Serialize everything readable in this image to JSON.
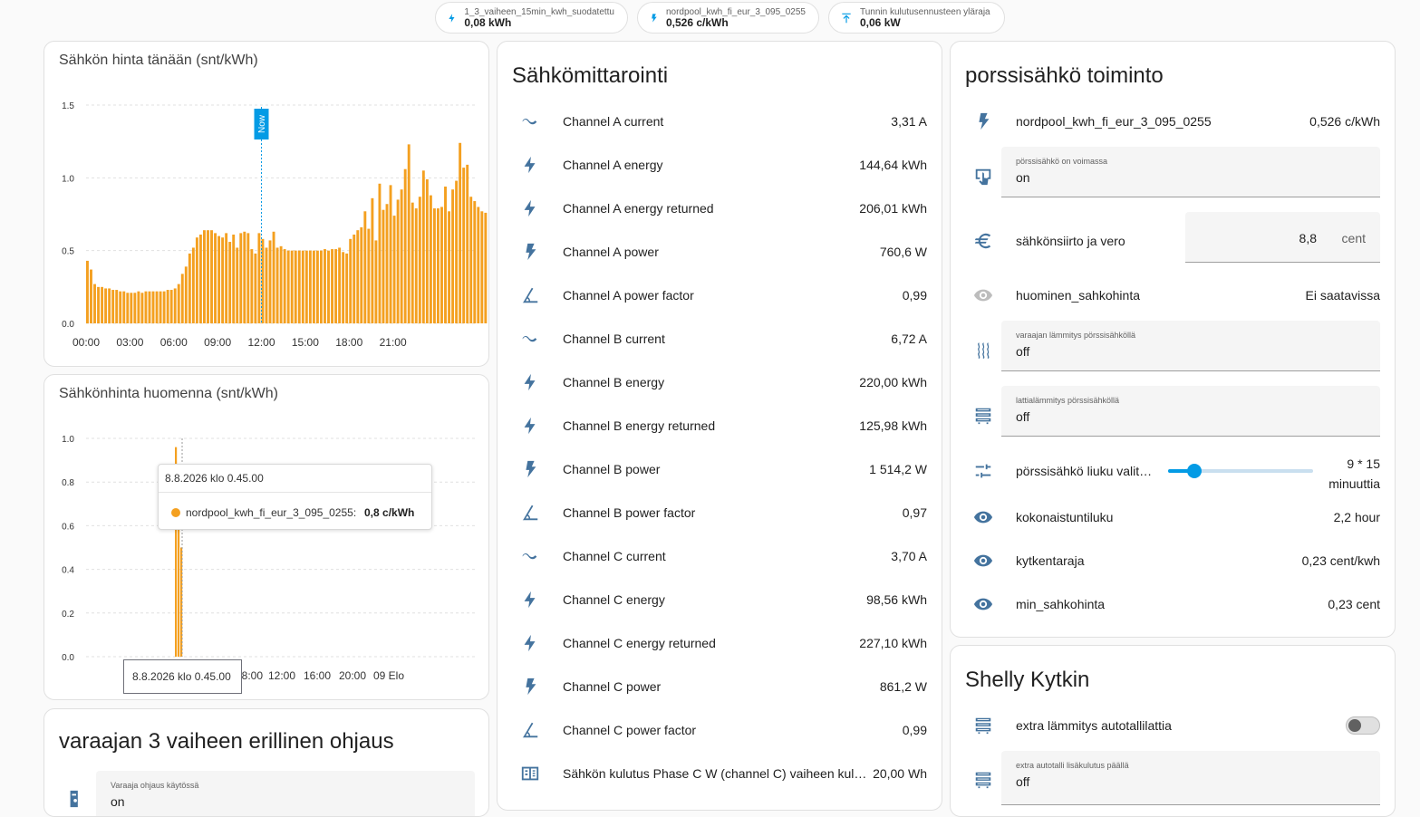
{
  "chips": [
    {
      "name": "1_3_vaiheen_15min_kwh_suodatettu",
      "value": "0,08 kWh",
      "icon": "flash-icon"
    },
    {
      "name": "nordpool_kwh_fi_eur_3_095_0255",
      "value": "0,526 c/kWh",
      "icon": "flash-icon"
    },
    {
      "name": "Tunnin kulutusennusteen yläraja",
      "value": "0,06 kW",
      "icon": "arrow-up-icon"
    }
  ],
  "chart_today": {
    "title": "Sähkön hinta tänään (snt/kWh)",
    "now_label": "Now"
  },
  "chart_tomorrow": {
    "title": "Sähkönhinta huomenna (snt/kWh)",
    "tooltip_title": "8.8.2026 klo 0.45.00",
    "tooltip_series": "nordpool_kwh_fi_eur_3_095_0255:",
    "tooltip_value": "0,8 c/kWh",
    "axis_pointer_label": "8.8.2026 klo 0.45.00"
  },
  "chart_data": [
    {
      "type": "bar",
      "title": "Sähkön hinta tänään (snt/kWh)",
      "ylim": [
        0,
        1.5
      ],
      "yticks": [
        "0.0",
        "0.5",
        "1.0",
        "1.5"
      ],
      "xticks": [
        "00:00",
        "03:00",
        "06:00",
        "09:00",
        "12:00",
        "15:00",
        "18:00",
        "21:00"
      ],
      "x_start_hour": 0,
      "step_minutes": 15,
      "now": "12:00",
      "color": "#f4a020",
      "values": [
        0.43,
        0.37,
        0.27,
        0.25,
        0.25,
        0.24,
        0.24,
        0.23,
        0.23,
        0.22,
        0.22,
        0.21,
        0.21,
        0.21,
        0.22,
        0.21,
        0.22,
        0.22,
        0.22,
        0.22,
        0.22,
        0.22,
        0.23,
        0.23,
        0.24,
        0.27,
        0.34,
        0.39,
        0.48,
        0.52,
        0.59,
        0.61,
        0.64,
        0.64,
        0.64,
        0.62,
        0.6,
        0.59,
        0.62,
        0.56,
        0.61,
        0.52,
        0.62,
        0.63,
        0.62,
        0.51,
        0.48,
        0.62,
        0.58,
        0.52,
        0.57,
        0.63,
        0.52,
        0.53,
        0.51,
        0.5,
        0.5,
        0.5,
        0.5,
        0.5,
        0.5,
        0.5,
        0.5,
        0.5,
        0.5,
        0.51,
        0.5,
        0.51,
        0.51,
        0.52,
        0.49,
        0.48,
        0.58,
        0.61,
        0.64,
        0.66,
        0.77,
        0.65,
        0.86,
        0.57,
        0.96,
        0.78,
        0.82,
        0.95,
        0.74,
        0.85,
        0.92,
        1.06,
        1.23,
        0.83,
        0.79,
        0.87,
        1.05,
        0.99,
        0.88,
        0.79,
        0.79,
        0.8,
        0.94,
        0.77,
        0.92,
        0.98,
        1.24,
        1.07,
        1.09,
        0.87,
        0.84,
        0.8,
        0.77,
        0.76
      ]
    },
    {
      "type": "bar",
      "title": "Sähkönhinta huomenna (snt/kWh)",
      "ylim": [
        0,
        1.0
      ],
      "yticks": [
        "0.0",
        "0.2",
        "0.4",
        "0.6",
        "0.8",
        "1.0"
      ],
      "xticks": [
        "08:00",
        "12:00",
        "16:00",
        "20:00",
        "09 Elo"
      ],
      "color": "#f4a020",
      "values": [
        0.96,
        0.8,
        0.5
      ]
    }
  ],
  "metering": {
    "title": "Sähkömittarointi",
    "rows": [
      {
        "icon": "current-ac-icon",
        "name": "Channel A current",
        "value": "3,31 A"
      },
      {
        "icon": "flash-icon",
        "name": "Channel A energy",
        "value": "144,64 kWh"
      },
      {
        "icon": "flash-icon",
        "name": "Channel A energy returned",
        "value": "206,01 kWh"
      },
      {
        "icon": "power-icon",
        "name": "Channel A power",
        "value": "760,6 W"
      },
      {
        "icon": "angle-icon",
        "name": "Channel A power factor",
        "value": "0,99"
      },
      {
        "icon": "current-ac-icon",
        "name": "Channel B current",
        "value": "6,72 A"
      },
      {
        "icon": "flash-icon",
        "name": "Channel B energy",
        "value": "220,00 kWh"
      },
      {
        "icon": "flash-icon",
        "name": "Channel B energy returned",
        "value": "125,98 kWh"
      },
      {
        "icon": "power-icon",
        "name": "Channel B power",
        "value": "1 514,2 W"
      },
      {
        "icon": "angle-icon",
        "name": "Channel B power factor",
        "value": "0,97"
      },
      {
        "icon": "current-ac-icon",
        "name": "Channel C current",
        "value": "3,70 A"
      },
      {
        "icon": "flash-icon",
        "name": "Channel C energy",
        "value": "98,56 kWh"
      },
      {
        "icon": "flash-icon",
        "name": "Channel C energy returned",
        "value": "227,10 kWh"
      },
      {
        "icon": "power-icon",
        "name": "Channel C power",
        "value": "861,2 W"
      },
      {
        "icon": "angle-icon",
        "name": "Channel C power factor",
        "value": "0,99"
      },
      {
        "icon": "meter-icon",
        "name": "Sähkön kulutus Phase C W (channel C) vaiheen kulutus",
        "value": "20,00 Wh"
      }
    ]
  },
  "porssi": {
    "title": "porssisähkö toiminto",
    "nordpool_name": "nordpool_kwh_fi_eur_3_095_0255",
    "nordpool_value": "0,526 c/kWh",
    "voimassa_label": "pörssisähkö on voimassa",
    "voimassa_value": "on",
    "siirto_name": "sähkönsiirto ja vero",
    "siirto_value": "8,8",
    "siirto_unit": "cent",
    "huominen_name": "huominen_sahkohinta",
    "huominen_value": "Ei saatavissa",
    "varaaja_label": "varaajan lämmitys pörssisähköllä",
    "varaaja_value": "off",
    "lattia_label": "lattialämmitys pörssisähköllä",
    "lattia_value": "off",
    "liuku_name": "pörssisähkö liuku valitsin",
    "liuku_value_line1": "9 * 15",
    "liuku_value_line2": "minuuttia",
    "liuku_fraction": 0.18,
    "kokonais_name": "kokonaistuntiluku",
    "kokonais_value": "2,2 hour",
    "kytkenta_name": "kytkentaraja",
    "kytkenta_value": "0,23 cent/kwh",
    "min_name": "min_sahkohinta",
    "min_value": "0,23 cent"
  },
  "shelly": {
    "title": "Shelly Kytkin",
    "extra_name": "extra lämmitys autotallilattia",
    "extra_on": false,
    "lisakulutus_label": "extra autotalli lisäkulutus päällä",
    "lisakulutus_value": "off"
  },
  "varaaja": {
    "title": "varaajan 3 vaiheen erillinen ohjaus",
    "ohjaus_label": "Varaaja ohjaus käytössä",
    "ohjaus_value": "on"
  },
  "colors": {
    "accent": "#039be5",
    "bar": "#f4a020",
    "icon": "#44739e"
  }
}
